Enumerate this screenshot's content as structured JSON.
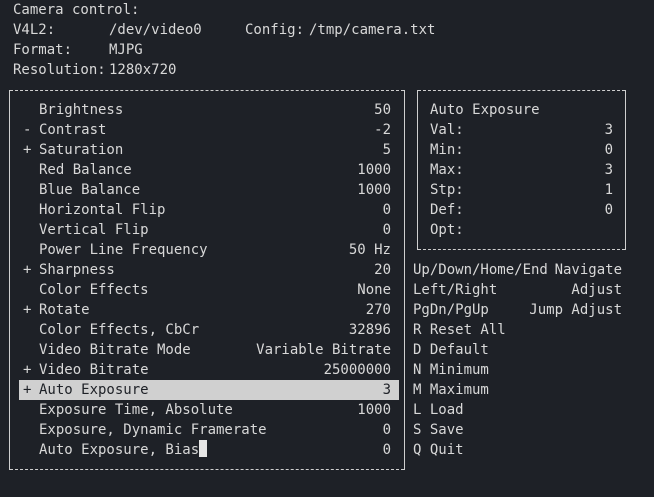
{
  "header": {
    "title": "Camera control:",
    "v4l2_label": "V4L2:",
    "v4l2_device": "/dev/video0",
    "config_label": "Config:",
    "config_path": "/tmp/camera.txt",
    "format_label": "Format:",
    "format_value": "MJPG",
    "resolution_label": "Resolution:",
    "resolution_value": "1280x720"
  },
  "controls": [
    {
      "marker": "",
      "label": "Brightness",
      "value": "50"
    },
    {
      "marker": "-",
      "label": "Contrast",
      "value": "-2"
    },
    {
      "marker": "+",
      "label": "Saturation",
      "value": "5"
    },
    {
      "marker": "",
      "label": "Red Balance",
      "value": "1000"
    },
    {
      "marker": "",
      "label": "Blue Balance",
      "value": "1000"
    },
    {
      "marker": "",
      "label": "Horizontal Flip",
      "value": "0"
    },
    {
      "marker": "",
      "label": "Vertical Flip",
      "value": "0"
    },
    {
      "marker": "",
      "label": "Power Line Frequency",
      "value": "50 Hz"
    },
    {
      "marker": "+",
      "label": "Sharpness",
      "value": "20"
    },
    {
      "marker": "",
      "label": "Color Effects",
      "value": "None"
    },
    {
      "marker": "+",
      "label": "Rotate",
      "value": "270"
    },
    {
      "marker": "",
      "label": "Color Effects, CbCr",
      "value": "32896"
    },
    {
      "marker": "",
      "label": "Video Bitrate Mode",
      "value": "Variable Bitrate"
    },
    {
      "marker": "+",
      "label": "Video Bitrate",
      "value": "25000000"
    },
    {
      "marker": "+",
      "label": "Auto Exposure",
      "value": "3",
      "selected": true
    },
    {
      "marker": "",
      "label": "Exposure Time, Absolute",
      "value": "1000"
    },
    {
      "marker": "",
      "label": "Exposure, Dynamic Framerate",
      "value": "0"
    },
    {
      "marker": "",
      "label": "Auto Exposure, Bias",
      "value": "0",
      "cursor": true
    }
  ],
  "info": {
    "title": "Auto Exposure",
    "rows": [
      {
        "key": "Val:",
        "value": "3"
      },
      {
        "key": "Min:",
        "value": "0"
      },
      {
        "key": "Max:",
        "value": "3"
      },
      {
        "key": "Stp:",
        "value": "1"
      },
      {
        "key": "Def:",
        "value": "0"
      },
      {
        "key": "Opt:",
        "value": ""
      }
    ]
  },
  "hotkeys": [
    {
      "key": "Up/Down/Home/End",
      "action": "Navigate"
    },
    {
      "key": "Left/Right",
      "action": "Adjust"
    },
    {
      "key": "PgDn/PgUp",
      "action": "Jump Adjust"
    },
    {
      "key": "R Reset All",
      "action": ""
    },
    {
      "key": "D Default",
      "action": ""
    },
    {
      "key": "N Minimum",
      "action": ""
    },
    {
      "key": "M Maximum",
      "action": ""
    },
    {
      "key": "L Load",
      "action": ""
    },
    {
      "key": "S Save",
      "action": ""
    },
    {
      "key": "Q Quit",
      "action": ""
    }
  ]
}
